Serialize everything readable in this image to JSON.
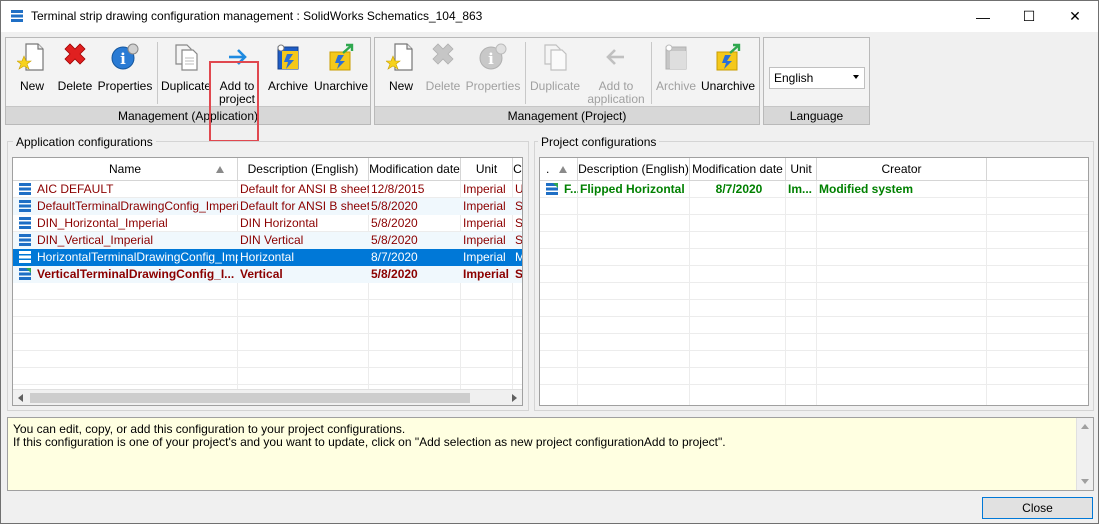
{
  "window": {
    "title": "Terminal strip drawing configuration management : SolidWorks Schematics_104_863",
    "minimize": "—",
    "maximize": "☐",
    "close": "✕"
  },
  "ribbon": {
    "app_group": {
      "title": "Management (Application)",
      "new_label": "New",
      "delete_label": "Delete",
      "properties_label": "Properties",
      "duplicate_label": "Duplicate",
      "add_to_project_line1": "Add to",
      "add_to_project_line2": "project",
      "archive_label": "Archive",
      "unarchive_label": "Unarchive"
    },
    "project_group": {
      "title": "Management (Project)",
      "new_label": "New",
      "delete_label": "Delete",
      "properties_label": "Properties",
      "duplicate_label": "Duplicate",
      "add_to_application_line1": "Add to",
      "add_to_application_line2": "application",
      "archive_label": "Archive",
      "unarchive_label": "Unarchive"
    },
    "language_group": {
      "title": "Language",
      "selected": "English"
    }
  },
  "app_panel": {
    "title": "Application configurations",
    "columns": [
      "Name",
      "Description (English)",
      "Modification date",
      "Unit",
      "C"
    ],
    "rows": [
      {
        "name": "AIC DEFAULT",
        "description": "Default for ANSI B sheet",
        "date": "12/8/2015",
        "unit": "Imperial",
        "extra": "Us"
      },
      {
        "name": "DefaultTerminalDrawingConfig_Imperial",
        "description": "Default for ANSI B sheet",
        "date": "5/8/2020",
        "unit": "Imperial",
        "extra": "Sy"
      },
      {
        "name": "DIN_Horizontal_Imperial",
        "description": "DIN Horizontal",
        "date": "5/8/2020",
        "unit": "Imperial",
        "extra": "Sy"
      },
      {
        "name": "DIN_Vertical_Imperial",
        "description": "DIN Vertical",
        "date": "5/8/2020",
        "unit": "Imperial",
        "extra": "Sy"
      },
      {
        "name": "HorizontalTerminalDrawingConfig_Impe...",
        "description": "Horizontal",
        "date": "8/7/2020",
        "unit": "Imperial",
        "extra": "M"
      },
      {
        "name": "VerticalTerminalDrawingConfig_I...",
        "description": "Vertical",
        "date": "5/8/2020",
        "unit": "Imperial",
        "extra": "S"
      }
    ]
  },
  "project_panel": {
    "title": "Project configurations",
    "columns": [
      ".",
      "Description (English)",
      "Modification date",
      "Unit",
      "Creator"
    ],
    "rows": [
      {
        "name": "F...",
        "description": "Flipped Horizontal",
        "date": "8/7/2020",
        "unit": "Im...",
        "creator": "Modified system"
      }
    ]
  },
  "info": {
    "line1": "You can edit, copy, or add this configuration to your project configurations.",
    "line2": "If this configuration is one of your project's and you want to update, click on \"Add selection as new project configurationAdd to project\"."
  },
  "footer": {
    "close_label": "Close"
  },
  "colors": {
    "row_text": "#8b0000",
    "project_row_text": "#008000",
    "selection": "#0078d7",
    "highlight_box": "#e0484f",
    "info_bg": "#ffffe1"
  }
}
